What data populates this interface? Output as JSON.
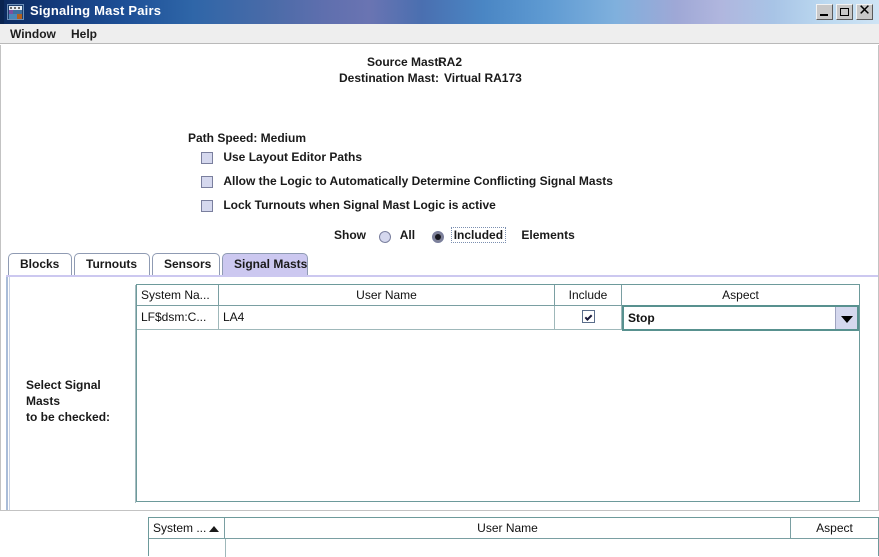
{
  "window": {
    "title": "Signaling Mast Pairs",
    "icon": "app-window-icon",
    "controls": {
      "minimize": "_",
      "maximize": "□",
      "close": "✕"
    }
  },
  "menubar": {
    "items": [
      {
        "label": "Window"
      },
      {
        "label": "Help"
      }
    ]
  },
  "header": {
    "source_mast_label": "Source Mast:",
    "source_mast_value": "RA2",
    "destination_mast_label": "Destination Mast:",
    "destination_mast_value": "Virtual RA173",
    "path_speed": "Path Speed: Medium"
  },
  "options": [
    {
      "label": "Use Layout Editor Paths",
      "checked": false
    },
    {
      "label": "Allow the Logic to Automatically Determine Conflicting Signal Masts",
      "checked": false
    },
    {
      "label": "Lock Turnouts when Signal Mast Logic is active",
      "checked": false
    }
  ],
  "show_row": {
    "prefix": "Show",
    "option_all": "All",
    "option_included": "Included",
    "suffix": "Elements",
    "selected": "Included"
  },
  "tabs": [
    {
      "label": "Blocks",
      "active": false
    },
    {
      "label": "Turnouts",
      "active": false
    },
    {
      "label": "Sensors",
      "active": false
    },
    {
      "label": "Signal Masts",
      "active": true
    }
  ],
  "left_caption": {
    "line1": "Select Signal Masts",
    "line2": "to be checked:"
  },
  "top_table": {
    "columns": [
      "System Na...",
      "User Name",
      "Include",
      "Aspect"
    ],
    "rows": [
      {
        "system_name": "LF$dsm:C...",
        "user_name": "LA4",
        "include": true,
        "aspect": "Stop"
      }
    ]
  },
  "bottom_table": {
    "columns": [
      "System ...",
      "User Name",
      "Aspect"
    ],
    "sort_column": "System ...",
    "sort_direction": "ascending",
    "rows": []
  },
  "colors": {
    "title_gradient_start": "#0c2a5e",
    "title_gradient_end": "#cfe4f5",
    "active_tab": "#ccc8f0",
    "table_border": "#6d9a9b",
    "editor_border": "#58918f",
    "checkbox_fill": "#d5d8ee"
  }
}
